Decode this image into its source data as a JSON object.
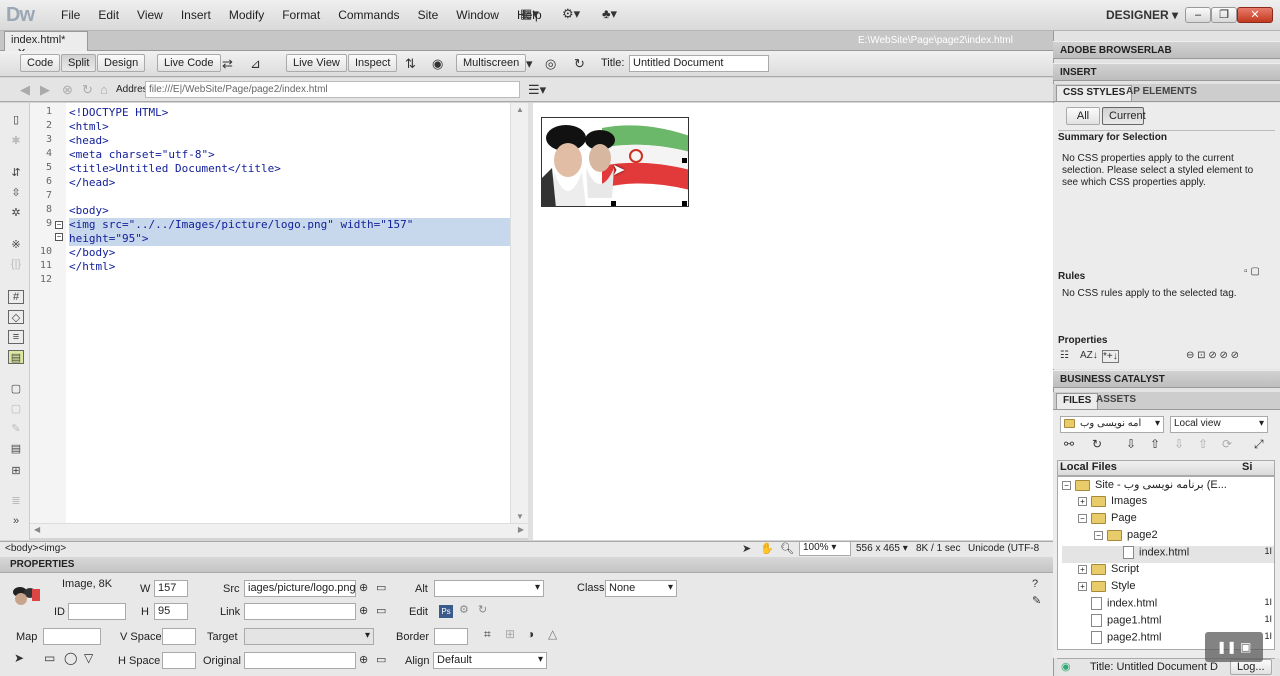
{
  "app": {
    "logo": "Dw",
    "workspace": "DESIGNER"
  },
  "menu": [
    "File",
    "Edit",
    "View",
    "Insert",
    "Modify",
    "Format",
    "Commands",
    "Site",
    "Window",
    "Help"
  ],
  "window_buttons": [
    "minimize",
    "restore",
    "close"
  ],
  "document": {
    "tab": "index.html*",
    "path": "E:\\WebSite\\Page\\page2\\index.html"
  },
  "toolbar": {
    "code": "Code",
    "split": "Split",
    "design": "Design",
    "live_code": "Live Code",
    "live_view": "Live View",
    "inspect": "Inspect",
    "multiscreen": "Multiscreen",
    "title_label": "Title:",
    "title_value": "Untitled Document"
  },
  "address": {
    "label": "Address:",
    "value": "file:///E|/WebSite/Page/page2/index.html"
  },
  "code_lines": [
    {
      "n": "1",
      "t": "<!DOCTYPE HTML>"
    },
    {
      "n": "2",
      "t": "<html>"
    },
    {
      "n": "3",
      "t": "<head>"
    },
    {
      "n": "4",
      "t": "<meta charset=\"utf-8\">"
    },
    {
      "n": "5",
      "t": "<title>Untitled Document</title>"
    },
    {
      "n": "6",
      "t": "</head>"
    },
    {
      "n": "7",
      "t": ""
    },
    {
      "n": "8",
      "t": "<body>"
    },
    {
      "n": "9",
      "t": "<img src=\"../../Images/picture/logo.png\" width=\"157\""
    },
    {
      "n": "",
      "t": "height=\"95\">"
    },
    {
      "n": "10",
      "t": "</body>"
    },
    {
      "n": "11",
      "t": "</html>"
    },
    {
      "n": "12",
      "t": ""
    }
  ],
  "status": {
    "tags": "<body><img>",
    "zoom": "100%",
    "size": "556 x 465",
    "weight": "8K / 1 sec",
    "encoding": "Unicode (UTF-8"
  },
  "properties": {
    "header": "PROPERTIES",
    "type": "Image, 8K",
    "w_label": "W",
    "w": "157",
    "h_label": "H",
    "h": "95",
    "id_label": "ID",
    "id": "",
    "src_label": "Src",
    "src": "iages/picture/logo.png",
    "link_label": "Link",
    "link": "",
    "alt_label": "Alt",
    "alt": "",
    "edit_label": "Edit",
    "class_label": "Class",
    "class": "None",
    "map_label": "Map",
    "map": "",
    "vspace_label": "V Space",
    "vspace": "",
    "target_label": "Target",
    "target": "",
    "border_label": "Border",
    "border": "",
    "hspace_label": "H Space",
    "hspace": "",
    "original_label": "Original",
    "original": "",
    "align_label": "Align",
    "align": "Default"
  },
  "panels": {
    "browserlab": "ADOBE BROWSERLAB",
    "insert": "INSERT",
    "css_tab": "CSS STYLES",
    "ap_tab": "AP ELEMENTS",
    "all": "All",
    "current": "Current",
    "summary_title": "Summary for Selection",
    "summary_text": "No CSS properties apply to the current selection.  Please select a styled element to see which CSS properties apply.",
    "rules_title": "Rules",
    "rules_text": "No CSS rules apply to the selected tag.",
    "properties_title": "Properties",
    "business": "BUSINESS CATALYST",
    "files_tab": "FILES",
    "assets_tab": "ASSETS",
    "site_select": "امه نویسی وب",
    "view_select": "Local view",
    "local_files": "Local Files",
    "size_col": "Si",
    "title_status": "Title: Untitled Document  D",
    "log_btn": "Log..."
  },
  "files": [
    {
      "label": "Site - برنامه نویسی وب (E...",
      "kind": "folder",
      "indent": 0,
      "exp": "−",
      "size": ""
    },
    {
      "label": "Images",
      "kind": "folder",
      "indent": 1,
      "exp": "+",
      "size": ""
    },
    {
      "label": "Page",
      "kind": "folder",
      "indent": 1,
      "exp": "−",
      "size": ""
    },
    {
      "label": "page2",
      "kind": "folder",
      "indent": 2,
      "exp": "−",
      "size": ""
    },
    {
      "label": "index.html",
      "kind": "file",
      "indent": 3,
      "exp": "",
      "size": "1I"
    },
    {
      "label": "Script",
      "kind": "folder",
      "indent": 1,
      "exp": "+",
      "size": ""
    },
    {
      "label": "Style",
      "kind": "folder",
      "indent": 1,
      "exp": "+",
      "size": ""
    },
    {
      "label": "index.html",
      "kind": "file",
      "indent": 1,
      "exp": "",
      "size": "1I"
    },
    {
      "label": "page1.html",
      "kind": "file",
      "indent": 1,
      "exp": "",
      "size": "1I"
    },
    {
      "label": "page2.html",
      "kind": "file",
      "indent": 1,
      "exp": "",
      "size": "1I"
    }
  ]
}
